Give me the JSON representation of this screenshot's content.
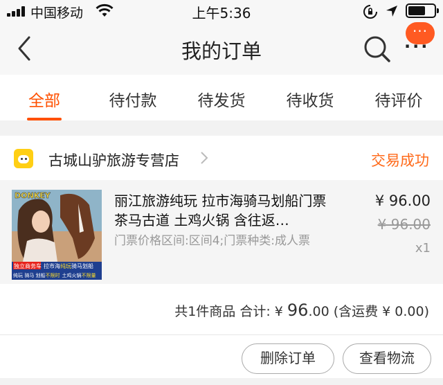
{
  "status_bar": {
    "carrier": "中国移动",
    "time": "上午5:36"
  },
  "nav": {
    "title": "我的订单",
    "more_badge": "···",
    "icons": [
      "back-icon",
      "search-icon",
      "more-icon"
    ]
  },
  "tabs": [
    {
      "label": "全部",
      "active": true
    },
    {
      "label": "待付款",
      "active": false
    },
    {
      "label": "待发货",
      "active": false
    },
    {
      "label": "待收货",
      "active": false
    },
    {
      "label": "待评价",
      "active": false
    }
  ],
  "order": {
    "shop_name": "古城山驴旅游专营店",
    "status": "交易成功",
    "item": {
      "title": "丽江旅游纯玩 拉市海骑马划船门票 茶马古道 土鸡火锅 含往返…",
      "sku": "门票价格区间:区间4;门票种类:成人票",
      "price": "¥ 96.00",
      "original_price": "¥ 96.00",
      "quantity": "x1",
      "thumb_text": {
        "brand": "DONKEY",
        "badge": "独立商务车",
        "tagline_pre": "拉市海",
        "tagline_hl": "纯玩",
        "tagline_post": "骑马划船",
        "features": "纯玩  骑马  划船",
        "feature_hl_1": "不限时",
        "feature_mid": "土鸡火锅",
        "feature_hl_2": "不限量"
      }
    },
    "summary": {
      "prefix": "共1件商品  合计: ¥ ",
      "total": "96",
      "decimals": ".00",
      "shipping": " (含运费 ¥ 0.00)"
    },
    "buttons": {
      "delete": "删除订单",
      "logistics": "查看物流"
    }
  },
  "colors": {
    "accent": "#ff5000",
    "status": "#ff6a1a",
    "badge": "#ff5a22"
  }
}
